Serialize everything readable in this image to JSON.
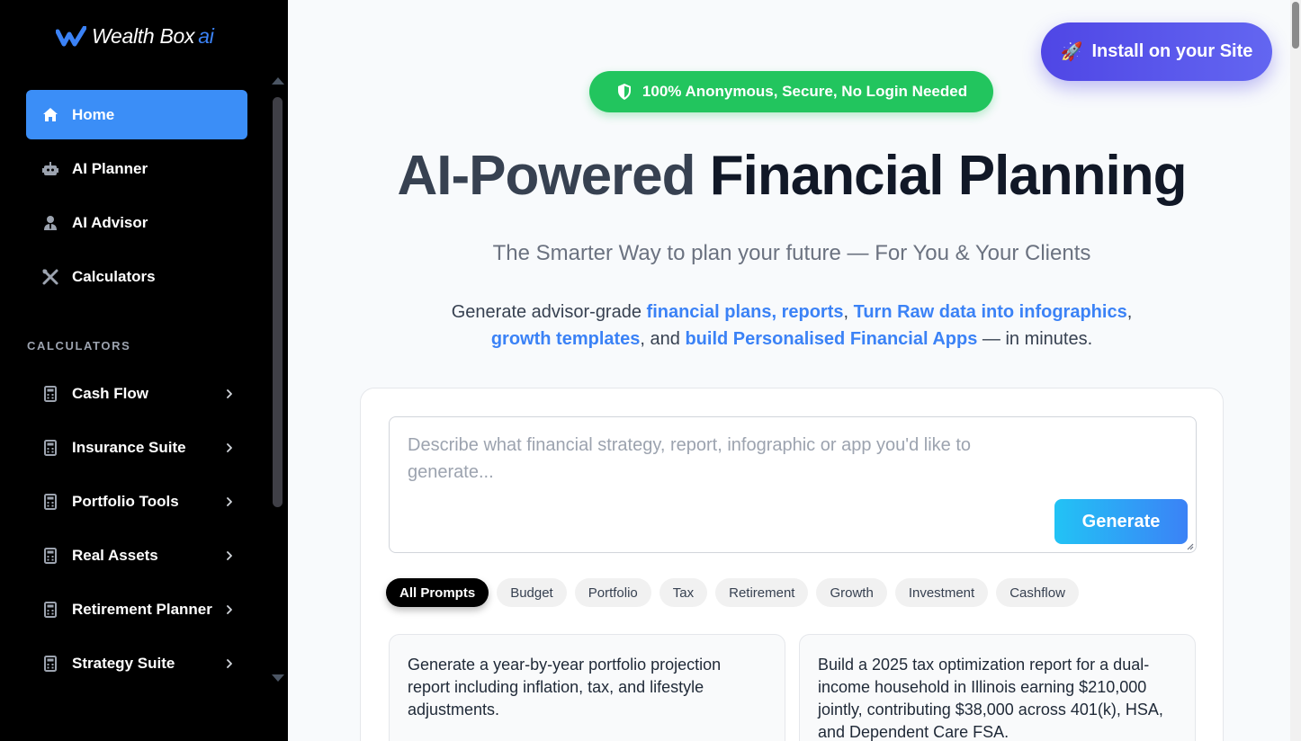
{
  "brand": {
    "name": "Wealth Box",
    "suffix": "ai"
  },
  "sidebar": {
    "nav": [
      {
        "label": "Home",
        "icon": "home-icon",
        "active": true
      },
      {
        "label": "AI Planner",
        "icon": "robot-icon"
      },
      {
        "label": "AI Advisor",
        "icon": "user-tie-icon"
      },
      {
        "label": "Calculators",
        "icon": "tools-icon"
      }
    ],
    "section_label": "CALCULATORS",
    "calculators": [
      {
        "label": "Cash Flow",
        "icon": "calculator-icon"
      },
      {
        "label": "Insurance Suite",
        "icon": "calculator-icon"
      },
      {
        "label": "Portfolio Tools",
        "icon": "calculator-icon"
      },
      {
        "label": "Real Assets",
        "icon": "calculator-icon"
      },
      {
        "label": "Retirement Planner",
        "icon": "calculator-icon"
      },
      {
        "label": "Strategy Suite",
        "icon": "calculator-icon"
      }
    ]
  },
  "header": {
    "install_label": "Install on your Site",
    "badge_label": "100% Anonymous, Secure, No Login Needed"
  },
  "hero": {
    "title_part1": "AI-Powered ",
    "title_part2": "Financial Planning",
    "subtitle": "The Smarter Way to plan your future — For You & Your Clients",
    "desc": {
      "t1": "Generate advisor-grade ",
      "h1": "financial plans, reports",
      "t2": ", ",
      "h2": "Turn Raw data into infographics",
      "t3": ",",
      "h3": "growth templates",
      "t4": ", and ",
      "h4": "build Personalised Financial Apps",
      "t5": " — in minutes."
    }
  },
  "generator": {
    "placeholder": "Describe what financial strategy, report, infographic or app you'd like to generate...",
    "button_label": "Generate",
    "chips": [
      "All Prompts",
      "Budget",
      "Portfolio",
      "Tax",
      "Retirement",
      "Growth",
      "Investment",
      "Cashflow"
    ],
    "active_chip": 0,
    "examples": [
      "Generate a year-by-year portfolio projection report including inflation, tax, and lifestyle adjustments.",
      "Build a 2025 tax optimization report for a dual-income household in Illinois earning $210,000 jointly, contributing $38,000 across 401(k), HSA, and Dependent Care FSA."
    ]
  },
  "colors": {
    "accent": "#3b8ef7",
    "badge_green": "#22c55e",
    "install_indigo": "#4f46e5"
  }
}
